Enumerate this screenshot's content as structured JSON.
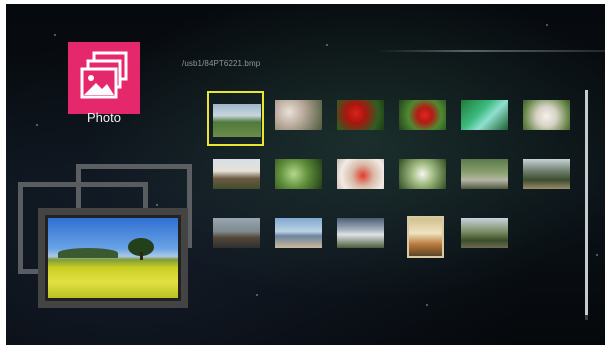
{
  "app": {
    "title": "Photo",
    "icon": "photo-gallery-icon",
    "accent": "#e5276b"
  },
  "browser": {
    "path": "/usb1/84PT6221.bmp"
  },
  "preview": {
    "icon": "stacked-photos-preview"
  },
  "thumbnails": [
    {
      "name": "park-lawn",
      "selected": true
    },
    {
      "name": "blossom-tree",
      "selected": false
    },
    {
      "name": "red-strawberries",
      "selected": false
    },
    {
      "name": "strawberry-plant",
      "selected": false
    },
    {
      "name": "garden-stream",
      "selected": false
    },
    {
      "name": "white-flowers",
      "selected": false
    },
    {
      "name": "old-house",
      "selected": false
    },
    {
      "name": "leafy-branch",
      "selected": false
    },
    {
      "name": "strawberry-hand",
      "selected": false
    },
    {
      "name": "white-lily",
      "selected": false
    },
    {
      "name": "forest-path",
      "selected": false
    },
    {
      "name": "tree-avenue",
      "selected": false
    },
    {
      "name": "train-station",
      "selected": false
    },
    {
      "name": "beach-shore",
      "selected": false
    },
    {
      "name": "cloudy-landscape",
      "selected": false
    },
    {
      "name": "interior-room",
      "selected": false
    },
    {
      "name": "tall-trees",
      "selected": false
    }
  ],
  "scrollbar": {
    "position": 0
  },
  "colors": {
    "selection": "#e9e633",
    "background": "#0a1117"
  }
}
